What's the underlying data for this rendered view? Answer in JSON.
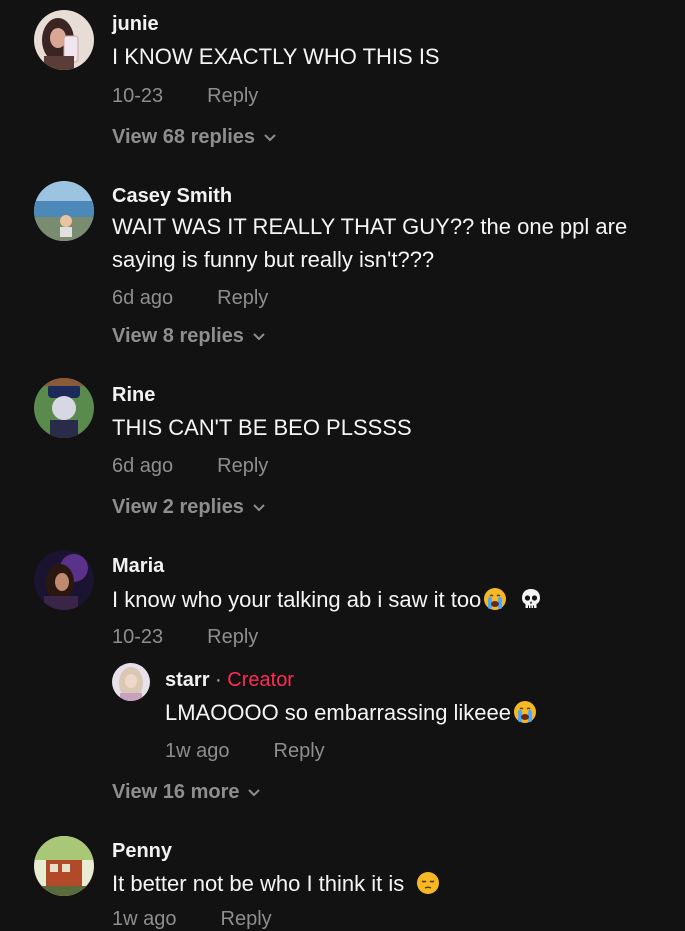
{
  "comments": [
    {
      "username": "junie",
      "text": "I KNOW EXACTLY WHO THIS IS",
      "time": "10-23",
      "reply_label": "Reply",
      "view_replies": "View 68 replies"
    },
    {
      "username": "Casey Smith",
      "text": "WAIT WAS IT REALLY THAT GUY?? the one ppl are saying is funny but really isn't???",
      "time": "6d ago",
      "reply_label": "Reply",
      "view_replies": "View 8 replies"
    },
    {
      "username": "Rine",
      "text": "THIS CAN'T BE BEO PLSSSS",
      "time": "6d ago",
      "reply_label": "Reply",
      "view_replies": "View 2 replies"
    },
    {
      "username": "Maria",
      "text": "I know who your talking ab i saw it too",
      "emojis": [
        "crying-face",
        "skull"
      ],
      "time": "10-23",
      "reply_label": "Reply",
      "nested_reply": {
        "username": "starr",
        "separator": "·",
        "badge": "Creator",
        "text": "LMAOOOO so embarrassing likeee",
        "emojis": [
          "crying-face"
        ],
        "time": "1w ago",
        "reply_label": "Reply"
      },
      "view_more": "View 16 more"
    },
    {
      "username": "Penny",
      "text": "It better not be who I think it is",
      "emojis": [
        "pensive-face"
      ],
      "time": "1w ago",
      "reply_label": "Reply"
    }
  ],
  "colors": {
    "background": "#121212",
    "muted": "#8e8e8e",
    "creator_badge": "#fe2c55"
  }
}
